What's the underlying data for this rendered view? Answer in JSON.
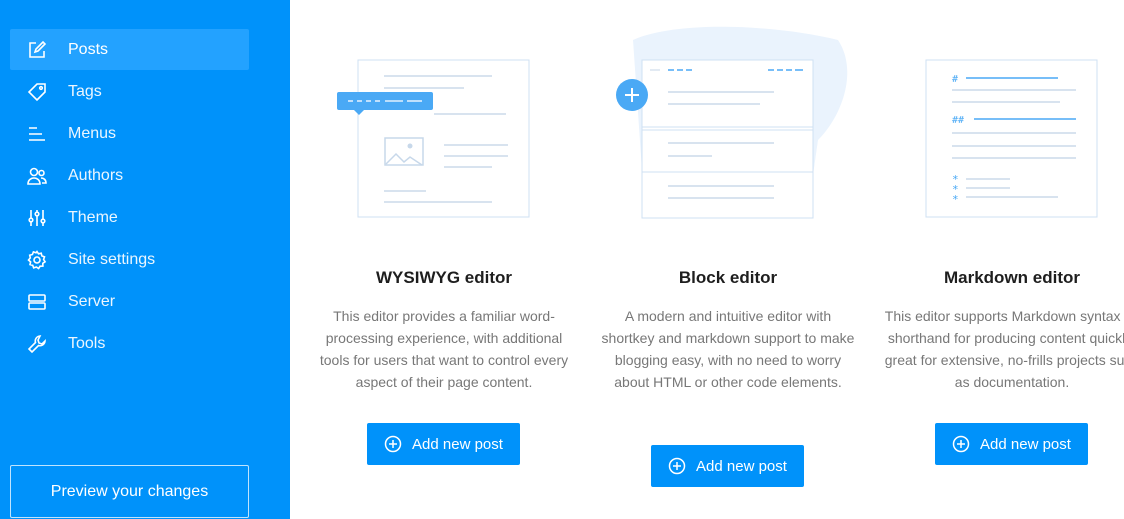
{
  "sidebar": {
    "items": [
      {
        "label": "Posts",
        "icon": "edit-icon",
        "active": true
      },
      {
        "label": "Tags",
        "icon": "tag-icon"
      },
      {
        "label": "Menus",
        "icon": "menu-icon"
      },
      {
        "label": "Authors",
        "icon": "users-icon"
      },
      {
        "label": "Theme",
        "icon": "sliders-icon"
      },
      {
        "label": "Site settings",
        "icon": "gear-icon"
      },
      {
        "label": "Server",
        "icon": "server-icon"
      },
      {
        "label": "Tools",
        "icon": "wrench-icon"
      }
    ],
    "preview_label": "Preview your changes"
  },
  "editors": [
    {
      "title": "WYSIWYG editor",
      "desc": "This editor provides a familiar word-processing experience, with additional tools for users that want to control every aspect of their page content.",
      "button": "Add new post"
    },
    {
      "title": "Block editor",
      "desc": "A modern and intuitive editor with shortkey and markdown support to make blogging easy, with no need to worry about HTML or other code elements.",
      "button": "Add new post"
    },
    {
      "title": "Markdown editor",
      "desc": "This editor supports Markdown syntax as shorthand for producing content quickly; great for extensive, no-frills projects such as documentation.",
      "button": "Add new post"
    }
  ],
  "colors": {
    "accent": "#0092fa",
    "sidebar_active": "#23a2ff"
  }
}
